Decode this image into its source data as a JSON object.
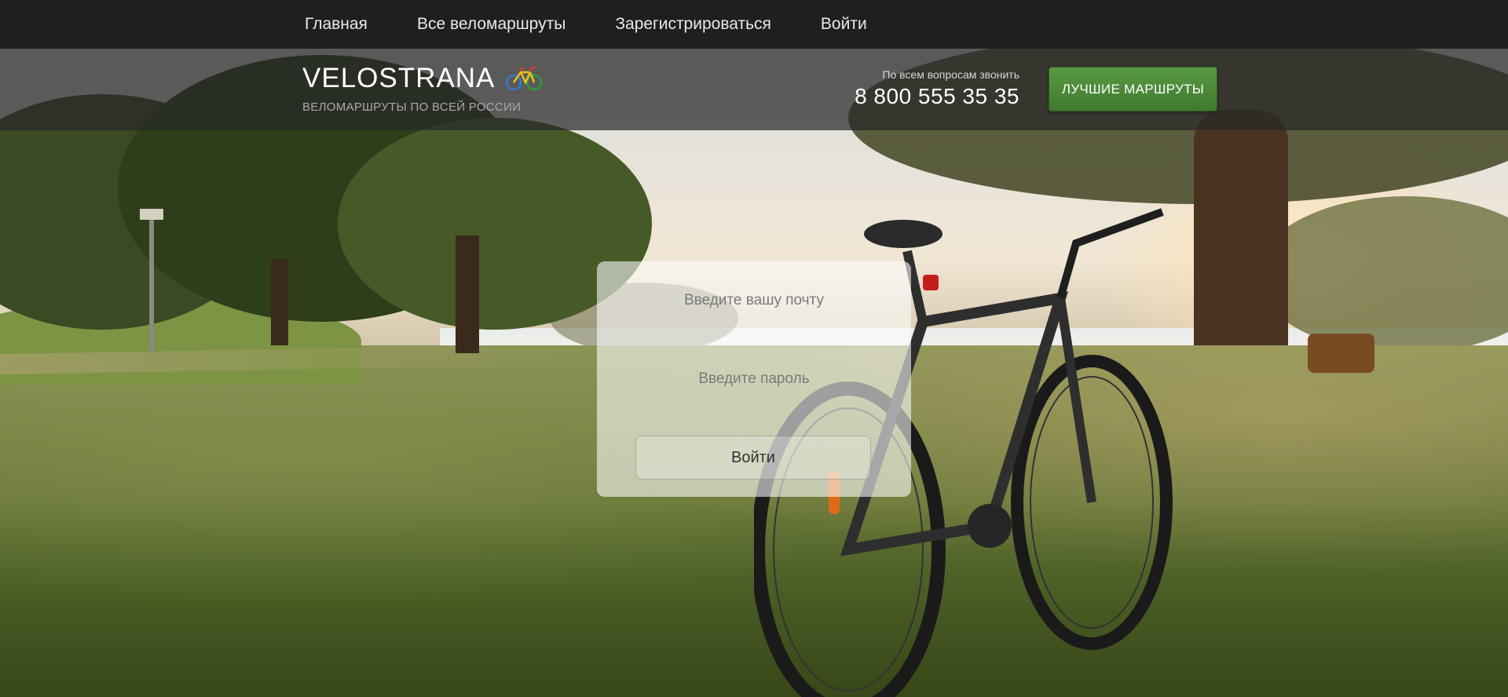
{
  "nav": {
    "items": [
      {
        "label": "Главная"
      },
      {
        "label": "Все веломаршруты"
      },
      {
        "label": "Зарегистрироваться"
      },
      {
        "label": "Войти"
      }
    ]
  },
  "header": {
    "brand_title": "VELOSTRANA",
    "brand_subtitle": "ВЕЛОМАРШРУТЫ ПО ВСЕЙ РОССИИ",
    "brand_icon": "bicycle-icon",
    "contact_label": "По всем вопросам звонить",
    "contact_phone": "8 800 555 35 35",
    "cta_label": "ЛУЧШИЕ МАРШРУТЫ"
  },
  "login": {
    "email_placeholder": "Введите вашу почту",
    "password_placeholder": "Введите пароль",
    "submit_label": "Войти"
  },
  "colors": {
    "topnav_bg": "#1f1f1f",
    "cta_green": "#4c8a3a"
  }
}
